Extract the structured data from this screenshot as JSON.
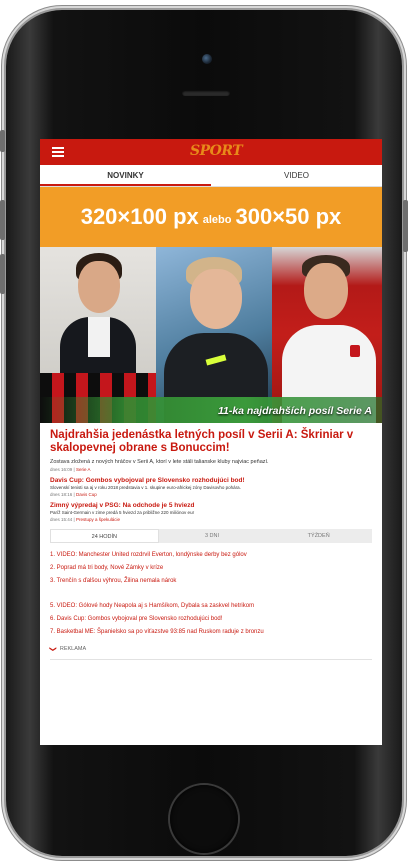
{
  "header": {
    "logo_prefix": "",
    "logo_text": "SPORT"
  },
  "tabs": [
    {
      "label": "NOVINKY",
      "active": true
    },
    {
      "label": "VIDEO",
      "active": false
    }
  ],
  "ad": {
    "size_large": "320×100 px",
    "conj": "alebo",
    "size_small": "300×50 px"
  },
  "hero": {
    "caption": "11-ka najdrahších posíl Serie A"
  },
  "article": {
    "headline": "Najdrahšia jedenástka letných posíl v Serii A: Škriniar v skalopevnej obrane s Bonuccim!",
    "lead": "Zostava zložená z nových hráčov v Serii A, ktorí v lete stáli talianske kluby najviac peňazí.",
    "time": "dnes 16:09",
    "tag": "Serie A"
  },
  "sub_articles": [
    {
      "title": "Davis Cup: Gombos vybojoval pre Slovensko rozhodujúci bod!",
      "lead": "Slovenskí tenisti sa aj v roku 2018 predstavia v 1. skupine euro-africkej zóny Davisovho pohára.",
      "time": "dnes 18:16",
      "tag": "Davis Cup"
    },
    {
      "title": "Zimný výpredaj v PSG: Na odchode je 5 hviezd",
      "lead": "Paríž Saint-Germain v zime predá 5 hviezd za približne 220 miliónov eur",
      "time": "dnes 15:44",
      "tag": "Prestupy a špekulácie"
    }
  ],
  "period_tabs": [
    {
      "label": "24 HODÍN",
      "active": true
    },
    {
      "label": "3 DNI",
      "active": false
    },
    {
      "label": "TÝŽDEŇ",
      "active": false
    }
  ],
  "top_list": [
    "1. VIDEO: Manchester United rozdrvil Everton, londýnske derby bez gólov",
    "2. Poprad má tri body, Nové Zámky v kríze",
    "3. Trenčín s ďalšou výhrou, Žilina nemala nárok",
    "5. VIDEO: Gólové hody Neapola aj s Hamšíkom, Dybala sa zaskvel hetrikom",
    "6. Davis Cup: Gombos vybojoval pre Slovensko rozhodujúci bod!",
    "7. Basketbal ME: Španielsko sa po víťazstve 93:85 nad Ruskom raduje z bronzu"
  ],
  "footer": {
    "reklama": "REKLAMA"
  },
  "colors": {
    "accent": "#c8190f",
    "ad_bg": "#f29d26"
  }
}
